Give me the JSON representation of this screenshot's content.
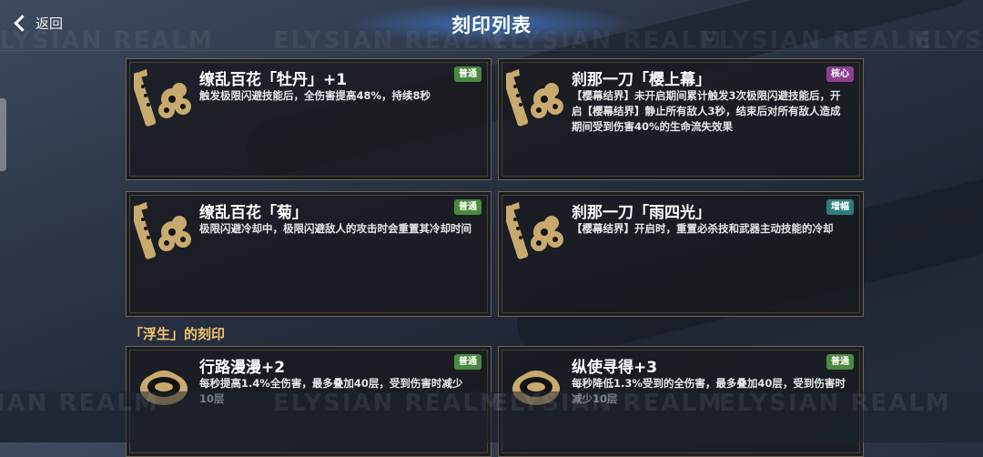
{
  "header": {
    "back_label": "返回",
    "title": "刻印列表"
  },
  "watermark": "ELYSIAN REALM",
  "colors": {
    "tag_normal": "#4b8a3e",
    "tag_core": "#8a3f8f",
    "tag_boost": "#2d7f7c",
    "section_label": "#f0c46d",
    "emblem_gold": "#c8aa6e"
  },
  "cards": [
    {
      "name": "缭乱百花「牡丹」+1",
      "desc": "触发极限闪避技能后，全伤害提高48%，持续8秒",
      "tag": "普通",
      "emblem": "sword-flower-icon"
    },
    {
      "name": "刹那一刀「樱上幕」",
      "desc": "【樱幕结界】未开启期间累计触发3次极限闪避技能后，开启【樱幕结界】静止所有敌人3秒，结束后对所有敌人造成期间受到伤害40%的生命流失效果",
      "tag": "核心",
      "emblem": "sword-flower-icon"
    },
    {
      "name": "缭乱百花「菊」",
      "desc": "极限闪避冷却中，极限闪避敌人的攻击时会重置其冷却时间",
      "tag": "普通",
      "emblem": "sword-flower-icon"
    },
    {
      "name": "刹那一刀「雨四光」",
      "desc": "【樱幕结界】开启时，重置必杀技和武器主动技能的冷却",
      "tag": "增幅",
      "emblem": "sword-flower-icon"
    },
    {
      "name": "行路漫漫+2",
      "desc": "每秒提高1.4%全伤害，最多叠加40层，受到伤害时减少10层",
      "tag": "普通",
      "emblem": "helmet-emblem-icon"
    },
    {
      "name": "纵使寻得+3",
      "desc": "每秒降低1.3%受到的全伤害，最多叠加40层，受到伤害时减少10层",
      "tag": "普通",
      "emblem": "helmet-emblem-icon"
    }
  ],
  "section": {
    "label": "「浮生」的刻印"
  }
}
